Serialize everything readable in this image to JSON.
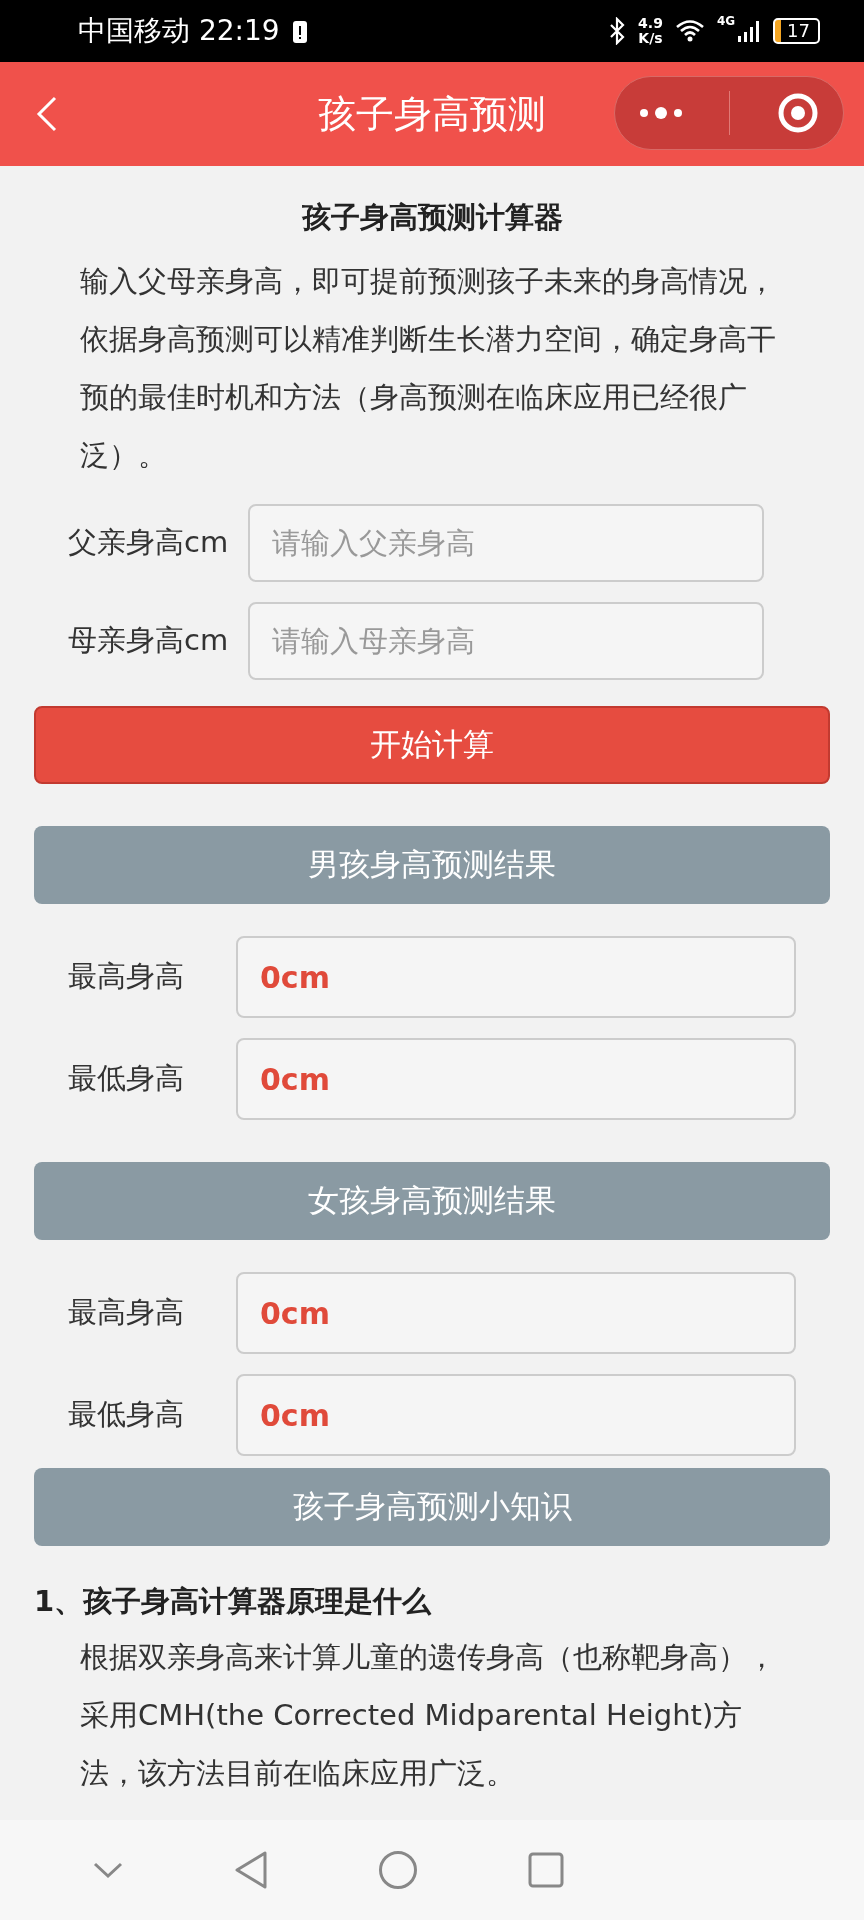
{
  "status_bar": {
    "carrier": "中国移动",
    "time": "22:19",
    "speed_value": "4.9",
    "speed_unit": "K/s",
    "network": "4G",
    "battery": "17"
  },
  "header": {
    "title": "孩子身高预测"
  },
  "calculator": {
    "title": "孩子身高预测计算器",
    "description": "输入父母亲身高，即可提前预测孩子未来的身高情况，依据身高预测可以精准判断生长潜力空间，确定身高干预的最佳时机和方法（身高预测在临床应用已经很广泛）。",
    "inputs": [
      {
        "label": "父亲身高cm",
        "placeholder": "请输入父亲身高"
      },
      {
        "label": "母亲身高cm",
        "placeholder": "请输入母亲身高"
      }
    ],
    "button": "开始计算"
  },
  "results": [
    {
      "heading": "男孩身高预测结果",
      "rows": [
        {
          "label": "最高身高",
          "value": "0cm"
        },
        {
          "label": "最低身高",
          "value": "0cm"
        }
      ]
    },
    {
      "heading": "女孩身高预测结果",
      "rows": [
        {
          "label": "最高身高",
          "value": "0cm"
        },
        {
          "label": "最低身高",
          "value": "0cm"
        }
      ]
    }
  ],
  "knowledge": {
    "heading": "孩子身高预测小知识",
    "items": [
      {
        "title": "1、孩子身高计算器原理是什么",
        "text": "根据双亲身高来计算儿童的遗传身高（也称靶身高），采用CMH(the Corrected Midparental Height)方法，该方法目前在临床应用广泛。"
      }
    ]
  }
}
